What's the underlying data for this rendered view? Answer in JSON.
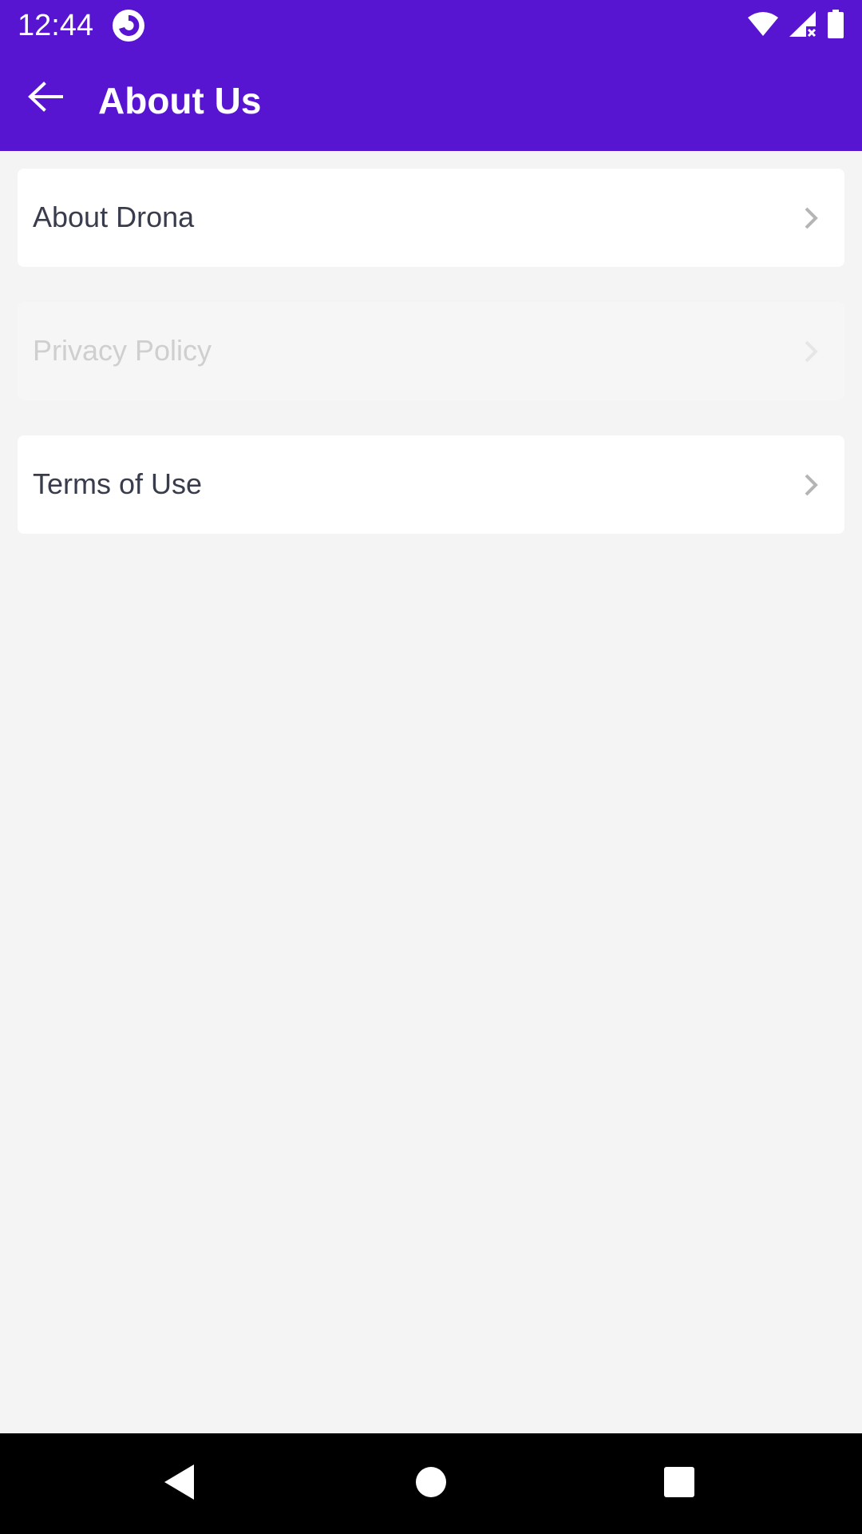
{
  "status_bar": {
    "time": "12:44",
    "icons": [
      "app-notification-icon",
      "wifi-icon",
      "signal-no-data-icon",
      "battery-icon"
    ]
  },
  "toolbar": {
    "title": "About Us",
    "back_icon": "arrow-left-icon"
  },
  "menu": {
    "items": [
      {
        "label": "About Drona",
        "enabled": true
      },
      {
        "label": "Privacy Policy",
        "enabled": false
      },
      {
        "label": "Terms of Use",
        "enabled": true
      }
    ]
  },
  "nav_bar": {
    "buttons": [
      "back-triangle-icon",
      "home-circle-icon",
      "recents-square-icon"
    ]
  },
  "colors": {
    "primary": "#5715d1",
    "background": "#f4f4f4",
    "card": "#ffffff",
    "text": "#383c4c",
    "disabled_text": "#cfcfcf"
  }
}
